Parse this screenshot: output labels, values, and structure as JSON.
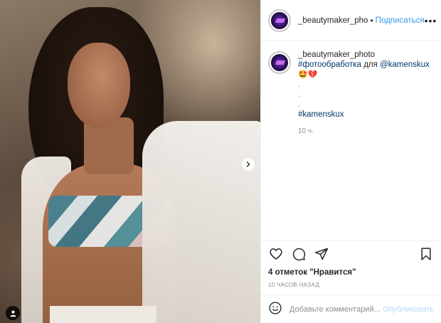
{
  "header": {
    "username": "_beautymaker_pho",
    "separator": "•",
    "follow_label": "Подписаться",
    "more_label": "•••"
  },
  "caption": {
    "username": "_beautymaker_photo",
    "hashtag_retouch": "#фотообработка",
    "for_text": "для",
    "mention": "@kamenskux",
    "emojis": "🤩💔",
    "dot1": ".",
    "dot2": ".",
    "dot3": ".",
    "hashtag_name": "#kamenskux",
    "time": "10 ч."
  },
  "actions": {
    "like_icon": "heart-icon",
    "comment_icon": "comment-icon",
    "share_icon": "share-icon",
    "save_icon": "bookmark-icon"
  },
  "likes_text": "4 отметок \"Нравится\"",
  "time_ago": "10 ЧАСОВ НАЗАД",
  "comment": {
    "placeholder": "Добавьте комментарий...",
    "publish_label": "Опубликовать"
  },
  "colors": {
    "link_blue": "#3897f0",
    "publish_disabled": "#b3dbff",
    "muted": "#8e8e8e",
    "border": "#efefef"
  }
}
